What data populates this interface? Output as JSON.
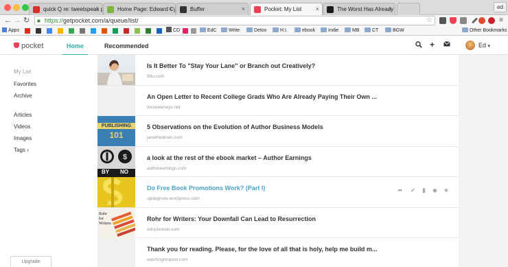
{
  "browser": {
    "tabs": [
      {
        "title": "quick Q re: tweetspeak posi",
        "favicon_color": "#d93025"
      },
      {
        "title": "Home Page: Edward Cyzew",
        "favicon_color": "#7cb342"
      },
      {
        "title": "Buffer",
        "favicon_color": "#333333"
      },
      {
        "title": "Pocket: My List",
        "favicon_color": "#ef4056",
        "active": true
      },
      {
        "title": "The Worst Has Already Hap",
        "favicon_color": "#1a1a1a"
      }
    ],
    "profile_label": "ed",
    "url_scheme": "https://",
    "url_rest": "getpocket.com/a/queue/list/",
    "bookmarks": {
      "apps": "Apps",
      "cd": "CD",
      "folders": [
        "EdC",
        "Write",
        "Detox",
        "H.I.",
        "ebook",
        "Indie",
        "MB",
        "CT",
        "BGW"
      ],
      "other": "Other Bookmarks"
    }
  },
  "pocket": {
    "logo_text": "pocket",
    "nav": {
      "home": "Home",
      "recommended": "Recommended"
    },
    "user_name": "Ed",
    "sidebar": {
      "items": [
        "My List",
        "Favorites",
        "Archive",
        "Articles",
        "Videos",
        "Images",
        "Tags"
      ],
      "tags_chevron": "›",
      "upgrade": "Upgrade"
    },
    "articles": [
      {
        "title": "Is It Better To \"Stay Your Lane\" or Branch out Creatively?",
        "domain": "99u.com"
      },
      {
        "title": "An Open Letter to Recent College Grads Who Are Already Paying Their Own ...",
        "domain": "mcsweeneys.net"
      },
      {
        "title": "5 Observations on the Evolution of Author Business Models",
        "domain": "janefriedman.com",
        "thumb_text": [
          "PUBLISHING",
          "101"
        ]
      },
      {
        "title": "a look at the rest of the ebook market – Author Earnings",
        "domain": "authorearnings.com",
        "thumb_text": [
          "BY",
          "NO"
        ]
      },
      {
        "title": "Do Free Book Promotions Work? (Part I)",
        "domain": "updegrove.wordpress.com",
        "highlighted": true
      },
      {
        "title": "Rohr for Writers: Your Downfall Can Lead to Resurrection",
        "domain": "edcyzewski.com",
        "thumb_text": [
          "Rohr",
          "for",
          "Writers"
        ]
      },
      {
        "title": "Thank you for reading. Please, for the love of all that is holy, help me build m...",
        "domain": "washingtonpost.com"
      }
    ],
    "colors": {
      "accent": "#2bb3a8",
      "link": "#4aa3c3",
      "brand": "#ef4056"
    }
  }
}
